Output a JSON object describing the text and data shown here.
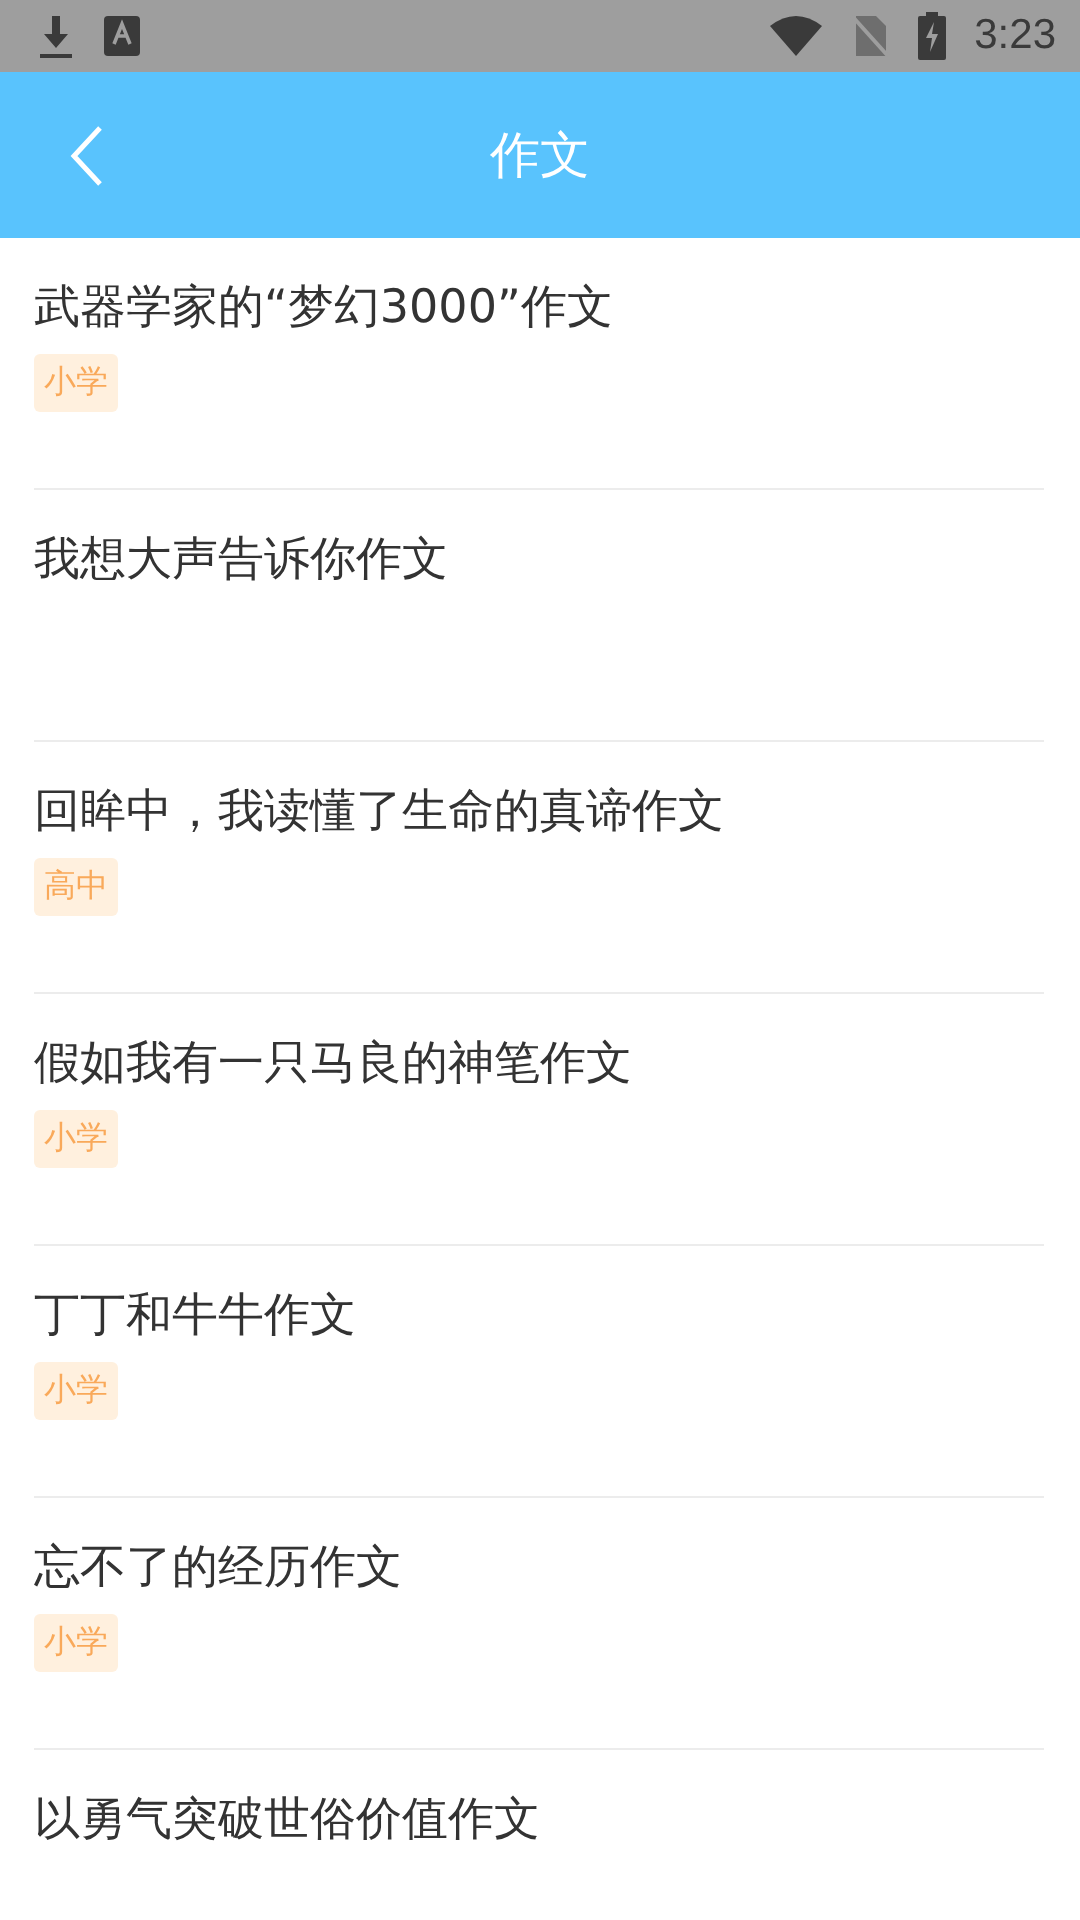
{
  "status_bar": {
    "time": "3:23"
  },
  "header": {
    "title": "作文"
  },
  "articles": [
    {
      "title": "武器学家的“梦幻3000”作文",
      "tag": "小学"
    },
    {
      "title": "我想大声告诉你作文"
    },
    {
      "title": "回眸中，我读懂了生命的真谛作文",
      "tag": "高中"
    },
    {
      "title": "假如我有一只马良的神笔作文",
      "tag": "小学"
    },
    {
      "title": "丁丁和牛牛作文",
      "tag": "小学"
    },
    {
      "title": "忘不了的经历作文",
      "tag": "小学"
    },
    {
      "title": "以勇气突破世俗价值作文"
    }
  ]
}
